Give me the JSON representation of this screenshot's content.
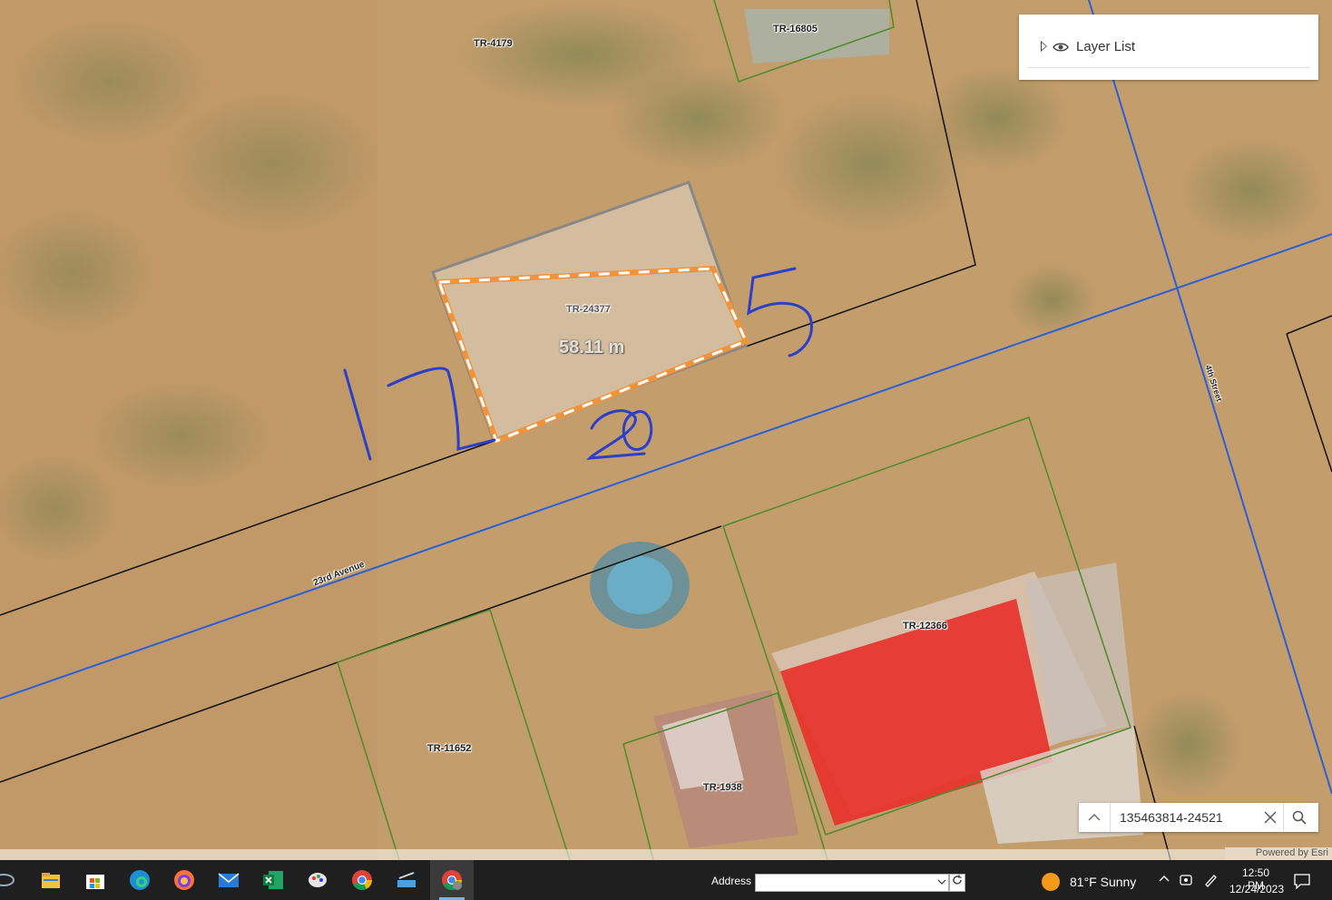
{
  "map": {
    "parcels": {
      "tr4179": "TR-4179",
      "tr16805": "TR-16805",
      "tr24377": "TR-24377",
      "tr12366": "TR-12366",
      "tr11652": "TR-11652",
      "tr1938": "TR-1938"
    },
    "streets": {
      "avenue": "23rd Avenue",
      "street": "4th Street"
    },
    "measurement": "58.11 m",
    "annotations": {
      "left": "17",
      "bottom": "20",
      "right": "5"
    },
    "attribution": "Powered by Esri"
  },
  "layer_list": {
    "title": "Layer List"
  },
  "search": {
    "value": "135463814-24521"
  },
  "taskbar": {
    "address_label": "Address",
    "address_value": "",
    "weather": "81°F  Sunny",
    "time": "12:50 PM",
    "date": "12/24/2023",
    "apps": [
      "file-explorer-icon",
      "store-icon",
      "edge-icon",
      "firefox-icon",
      "mail-icon",
      "excel-icon",
      "paint-icon",
      "chrome-icon",
      "scanner-icon",
      "chrome-profile-icon"
    ]
  },
  "colors": {
    "parcel_green": "#4f8a2c",
    "street_blue": "#2a5fd6",
    "boundary_black": "#111111",
    "measure_orange": "#f0943c",
    "handwriting_blue": "#2b3fc8"
  }
}
